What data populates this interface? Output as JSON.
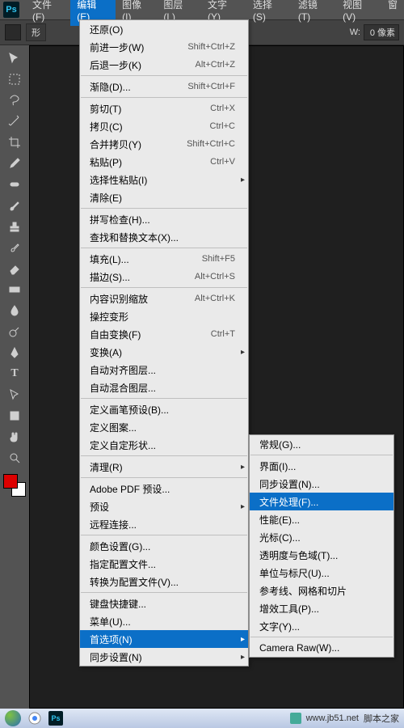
{
  "menubar": {
    "items": [
      "文件(F)",
      "编辑(E)",
      "图像(I)",
      "图层(L)",
      "文字(Y)",
      "选择(S)",
      "滤镜(T)",
      "视图(V)",
      "窗"
    ],
    "active_index": 1
  },
  "optbar": {
    "shape_label": "形",
    "w_label": "W:",
    "w_value": "0 像素"
  },
  "edit_menu": {
    "g1": [
      {
        "label": "还原(O)",
        "sc": ""
      },
      {
        "label": "前进一步(W)",
        "sc": "Shift+Ctrl+Z"
      },
      {
        "label": "后退一步(K)",
        "sc": "Alt+Ctrl+Z"
      }
    ],
    "g2": [
      {
        "label": "渐隐(D)...",
        "sc": "Shift+Ctrl+F"
      }
    ],
    "g3": [
      {
        "label": "剪切(T)",
        "sc": "Ctrl+X"
      },
      {
        "label": "拷贝(C)",
        "sc": "Ctrl+C"
      },
      {
        "label": "合并拷贝(Y)",
        "sc": "Shift+Ctrl+C"
      },
      {
        "label": "粘贴(P)",
        "sc": "Ctrl+V"
      },
      {
        "label": "选择性粘贴(I)",
        "sc": "",
        "sub": true
      },
      {
        "label": "清除(E)",
        "sc": ""
      }
    ],
    "g4": [
      {
        "label": "拼写检查(H)...",
        "sc": ""
      },
      {
        "label": "查找和替换文本(X)...",
        "sc": ""
      }
    ],
    "g5": [
      {
        "label": "填充(L)...",
        "sc": "Shift+F5"
      },
      {
        "label": "描边(S)...",
        "sc": "Alt+Ctrl+S"
      }
    ],
    "g6": [
      {
        "label": "内容识别缩放",
        "sc": "Alt+Ctrl+K"
      },
      {
        "label": "操控变形",
        "sc": ""
      },
      {
        "label": "自由变换(F)",
        "sc": "Ctrl+T"
      },
      {
        "label": "变换(A)",
        "sc": "",
        "sub": true
      },
      {
        "label": "自动对齐图层...",
        "sc": ""
      },
      {
        "label": "自动混合图层...",
        "sc": ""
      }
    ],
    "g7": [
      {
        "label": "定义画笔预设(B)...",
        "sc": ""
      },
      {
        "label": "定义图案...",
        "sc": ""
      },
      {
        "label": "定义自定形状...",
        "sc": ""
      }
    ],
    "g8": [
      {
        "label": "清理(R)",
        "sc": "",
        "sub": true
      }
    ],
    "g9": [
      {
        "label": "Adobe PDF 预设...",
        "sc": ""
      },
      {
        "label": "预设",
        "sc": "",
        "sub": true
      },
      {
        "label": "远程连接...",
        "sc": ""
      }
    ],
    "g10": [
      {
        "label": "颜色设置(G)...",
        "sc": ""
      },
      {
        "label": "指定配置文件...",
        "sc": ""
      },
      {
        "label": "转换为配置文件(V)...",
        "sc": ""
      }
    ],
    "g11": [
      {
        "label": "键盘快捷键...",
        "sc": ""
      },
      {
        "label": "菜单(U)...",
        "sc": ""
      },
      {
        "label": "首选项(N)",
        "sc": "",
        "sub": true,
        "hl": true
      },
      {
        "label": "同步设置(N)",
        "sc": "",
        "sub": true
      }
    ]
  },
  "prefs_submenu": {
    "g1": [
      {
        "label": "常规(G)..."
      }
    ],
    "g2": [
      {
        "label": "界面(I)..."
      },
      {
        "label": "同步设置(N)..."
      },
      {
        "label": "文件处理(F)...",
        "hl": true
      },
      {
        "label": "性能(E)..."
      },
      {
        "label": "光标(C)..."
      },
      {
        "label": "透明度与色域(T)..."
      },
      {
        "label": "单位与标尺(U)..."
      },
      {
        "label": "参考线、网格和切片"
      },
      {
        "label": "增效工具(P)..."
      },
      {
        "label": "文字(Y)..."
      }
    ],
    "g3": [
      {
        "label": "Camera Raw(W)..."
      }
    ]
  },
  "taskbar": {
    "site": "www.jb51.net",
    "brand": "脚本之家"
  }
}
